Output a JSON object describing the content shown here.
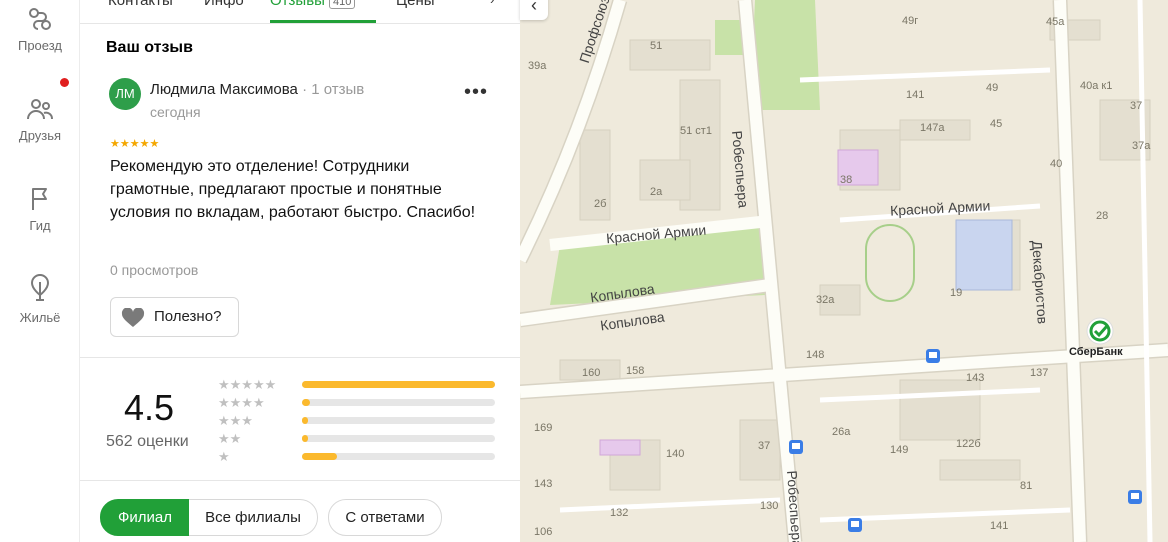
{
  "rail": {
    "items": [
      {
        "label": "Проезд",
        "icon": "route-icon"
      },
      {
        "label": "Друзья",
        "icon": "friends-icon"
      },
      {
        "label": "Гид",
        "icon": "flag-icon"
      },
      {
        "label": "Жильё",
        "icon": "housing-icon"
      }
    ]
  },
  "tabs": {
    "items": [
      "Контакты",
      "Инфо",
      "Отзывы",
      "Цены"
    ],
    "badge": "410",
    "active": "Отзывы"
  },
  "review": {
    "section_title": "Ваш отзыв",
    "avatar_initials": "ЛМ",
    "author": "Людмила Максимова",
    "author_reviews": "· 1 отзыв",
    "date": "сегодня",
    "more": "•••",
    "stars": "★★★★★",
    "text": "Рекомендую это отделение! Сотрудники грамотные, предлагают простые и понятные условия по вкладам, работают быстро. Спасибо!",
    "views": "0 просмотров",
    "useful_label": "Полезно?"
  },
  "rating": {
    "value": "4.5",
    "count": "562 оценки",
    "rows": [
      {
        "stars": "★★★★★",
        "fraction": 1.0
      },
      {
        "stars": "★★★★",
        "fraction": 0.04
      },
      {
        "stars": "★★★",
        "fraction": 0.03
      },
      {
        "stars": "★★",
        "fraction": 0.03
      },
      {
        "stars": "★",
        "fraction": 0.18
      }
    ]
  },
  "filters": {
    "branch": "Филиал",
    "all_branches": "Все филиалы",
    "with_answers": "С ответами"
  },
  "map": {
    "collapse": "‹",
    "streets": [
      "Профсоюзов",
      "Робеспьера",
      "Красной Армии",
      "Красной Армии",
      "Копылова",
      "Копылова",
      "Декабристов",
      "Робеспьера"
    ],
    "buildings": [
      "51",
      "51 ст1",
      "2а",
      "2б",
      "39а",
      "49г",
      "45а",
      "141",
      "49",
      "40а к1",
      "147а",
      "45",
      "37",
      "37а",
      "38",
      "40",
      "28",
      "19",
      "32а",
      "148",
      "160",
      "158",
      "143",
      "137",
      "169",
      "140",
      "37",
      "26а",
      "149",
      "122б",
      "130",
      "132",
      "81",
      "143",
      "141",
      "106"
    ],
    "poi": "СберБанк",
    "colors": {
      "background": "#efeadc",
      "park": "#c8e2a8",
      "road": "#ffffff",
      "major_road": "#fdfdf7",
      "highlight": "#e6c9ec",
      "school": "#c9d5ef"
    }
  }
}
